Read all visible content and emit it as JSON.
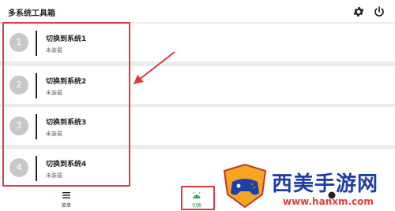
{
  "app": {
    "title": "多系统工具箱"
  },
  "header": {
    "icons": [
      "gear-icon",
      "power-icon"
    ]
  },
  "systems": [
    {
      "number": "1",
      "title": "切换到系统1",
      "status": "未装载"
    },
    {
      "number": "2",
      "title": "切换到系统2",
      "status": "未装载"
    },
    {
      "number": "3",
      "title": "切换到系统3",
      "status": "未装载"
    },
    {
      "number": "4",
      "title": "切换到系统4",
      "status": "未装载"
    }
  ],
  "bottom_nav": {
    "menu_label": "菜单",
    "switch_label": "切换",
    "third_label": "",
    "icons": [
      "menu-icon",
      "android-icon",
      "gamepad-icon"
    ]
  },
  "watermark": {
    "main": "西美手游网",
    "sub": "www.hanxm.com"
  },
  "colors": {
    "highlight": "#e0393e",
    "accent": "#2a9b4a",
    "watermark_blue": "#1f3fa8"
  }
}
